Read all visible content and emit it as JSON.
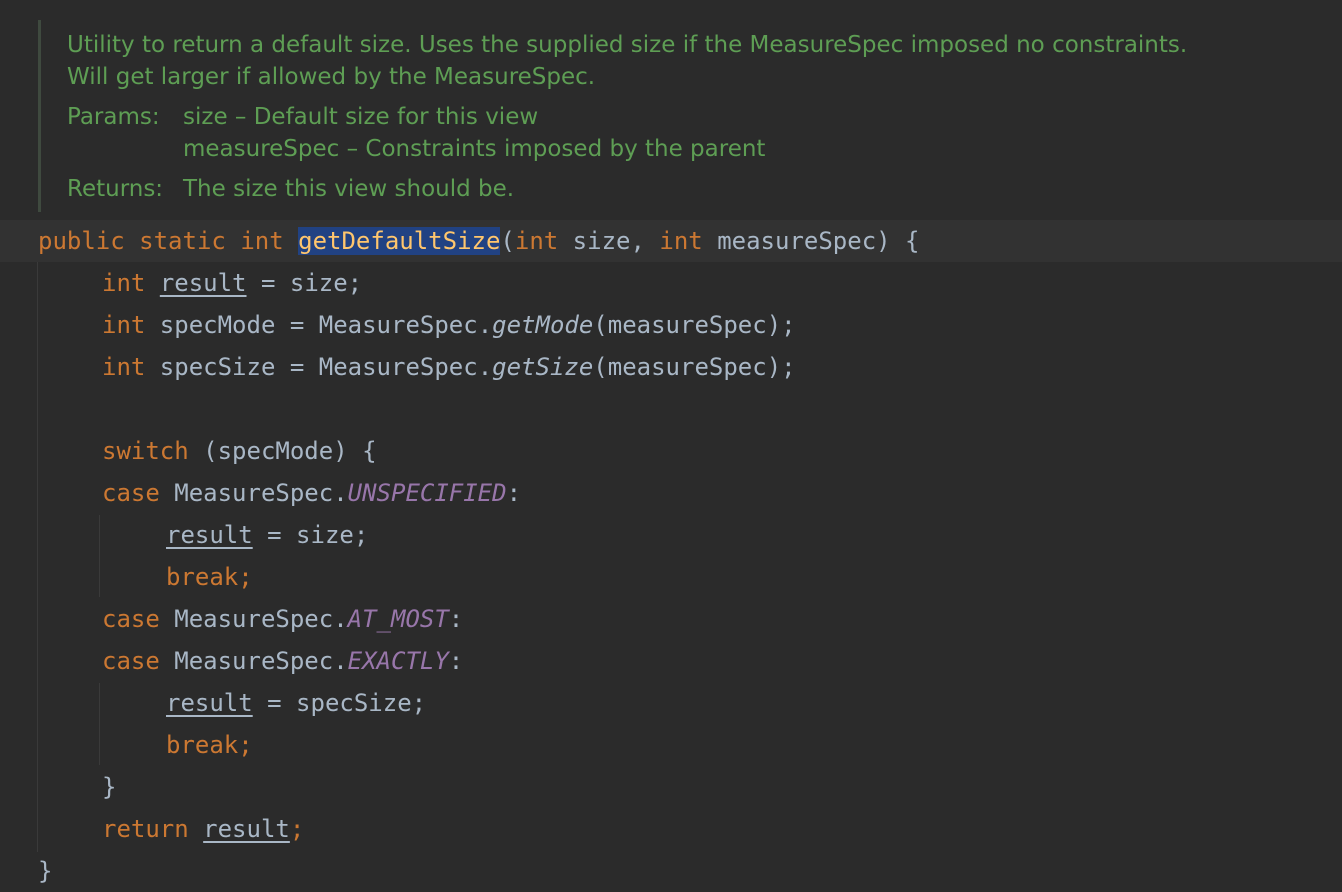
{
  "doc": {
    "description": "Utility to return a default size. Uses the supplied size if the MeasureSpec imposed no constraints. Will get larger if allowed by the MeasureSpec.",
    "params_label": "Params:",
    "param1": "size – Default size for this view",
    "param2": "measureSpec – Constraints imposed by the parent",
    "returns_label": "Returns:",
    "returns_text": "The size this view should be."
  },
  "code": {
    "sig_public": "public",
    "sig_static": "static",
    "sig_int": "int",
    "sig_name": "getDefaultSize",
    "sig_open": "(",
    "sig_int1": "int",
    "sig_p1": " size, ",
    "sig_int2": "int",
    "sig_p2": " measureSpec) {",
    "l1_int": "int",
    "l1_var": "result",
    "l1_rest": " = size;",
    "l2_int": "int",
    "l2_a": " specMode = MeasureSpec.",
    "l2_m": "getMode",
    "l2_b": "(measureSpec);",
    "l3_int": "int",
    "l3_a": " specSize = MeasureSpec.",
    "l3_m": "getSize",
    "l3_b": "(measureSpec);",
    "l4_kw": "switch",
    "l4_rest": " (specMode) {",
    "l5_kw": "case",
    "l5_a": " MeasureSpec.",
    "l5_c": "UNSPECIFIED",
    "l5_b": ":",
    "l6_var": "result",
    "l6_rest": " = size;",
    "break": "break;",
    "l8_kw": "case",
    "l8_a": " MeasureSpec.",
    "l8_c": "AT_MOST",
    "l8_b": ":",
    "l9_kw": "case",
    "l9_a": " MeasureSpec.",
    "l9_c": "EXACTLY",
    "l9_b": ":",
    "l10_var": "result",
    "l10_rest": " = specSize;",
    "close_brace": "}",
    "ret_kw": "return",
    "ret_var": "result",
    "ret_semi": ";",
    "final_brace": "}"
  },
  "colors": {
    "background": "#2b2b2b",
    "keyword": "#cc7832",
    "function": "#ffc66d",
    "constant": "#9876aa",
    "doc_comment": "#5e9e54",
    "selection": "#214283"
  }
}
